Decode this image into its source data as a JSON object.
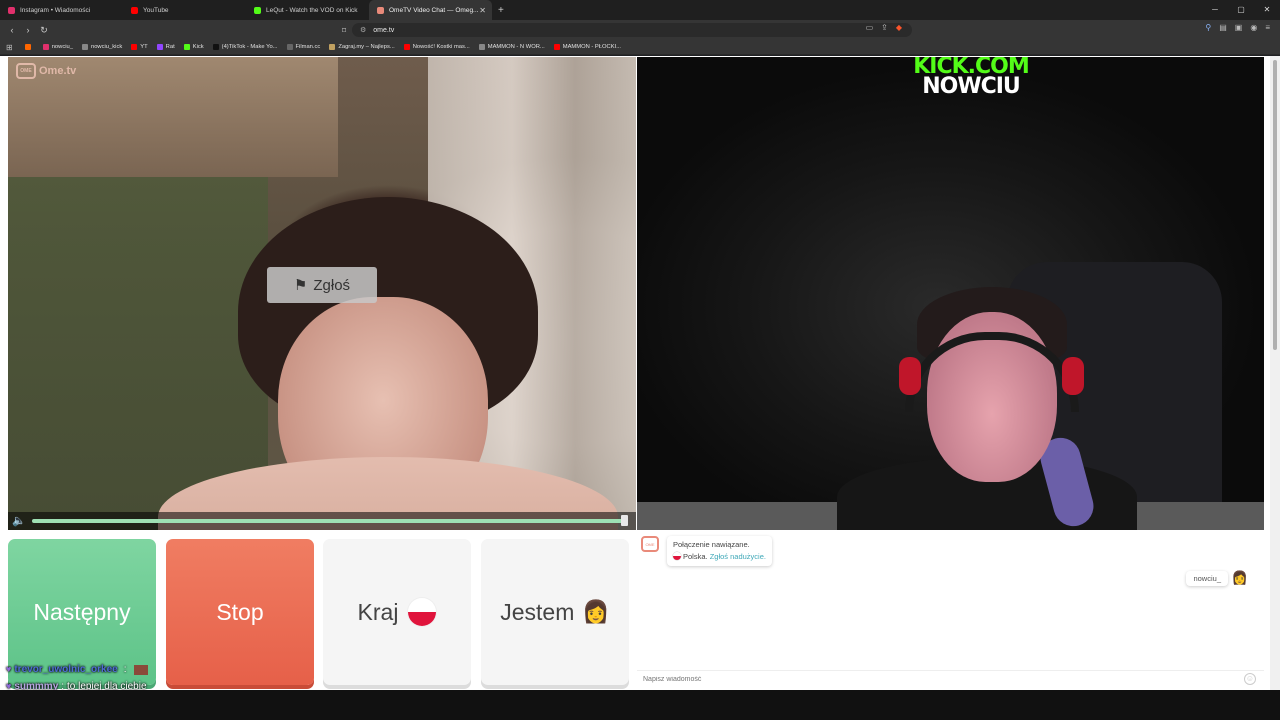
{
  "tabs": [
    {
      "title": "Instagram • Wiadomości",
      "color": "#e1306c"
    },
    {
      "title": "YouTube",
      "color": "#ff0000"
    },
    {
      "title": "LeQut - Watch the VOD on Kick",
      "color": "#53fc18"
    },
    {
      "title": "OmeTV Video Chat — Omeg...",
      "color": "#e98a7a",
      "active": true
    }
  ],
  "address": {
    "url": "ome.tv"
  },
  "bookmarks": [
    {
      "label": "",
      "color": "#ff6600"
    },
    {
      "label": "nowciu_",
      "color": "#e1306c"
    },
    {
      "label": "nowciu_kick",
      "color": "#888"
    },
    {
      "label": "YT",
      "color": "#ff0000"
    },
    {
      "label": "Rat",
      "color": "#9146ff"
    },
    {
      "label": "Kick",
      "color": "#53fc18"
    },
    {
      "label": "(4)TikTok - Make Yo...",
      "color": "#111"
    },
    {
      "label": "Filman.cc",
      "color": "#666"
    },
    {
      "label": "Zagraj.my – Najleps...",
      "color": "#c0a060"
    },
    {
      "label": "Nowość! Kostki mas...",
      "color": "#ff0000"
    },
    {
      "label": "MAMMON - N WOR...",
      "color": "#888"
    },
    {
      "label": "MAMMON - PŁOCKI...",
      "color": "#ff0000"
    }
  ],
  "remote": {
    "logo": "Ome.tv",
    "report_label": "Zgłoś"
  },
  "overlay": {
    "kick_line1": "KICK.COM",
    "kick_line2": "NOWCIU"
  },
  "buttons": {
    "next": "Następny",
    "stop": "Stop",
    "country": "Kraj",
    "gender": "Jestem",
    "gender_emoji": "👩"
  },
  "chat": {
    "system_line1": "Połączenie nawiązane.",
    "country": "Polska.",
    "report_link": "Zgłoś nadużycie.",
    "user_message": "nowciu_",
    "user_emoji": "👩",
    "input_placeholder": "Napisz wiadomość"
  },
  "stream_chat": [
    {
      "user": "trevor_uwolnic_orkee",
      "message": ""
    },
    {
      "user": "summmy",
      "message": "to lepiej dla ciebie"
    }
  ],
  "colors": {
    "next": "#6cc994",
    "stop": "#ea6b52",
    "kick_green": "#53fc18"
  }
}
